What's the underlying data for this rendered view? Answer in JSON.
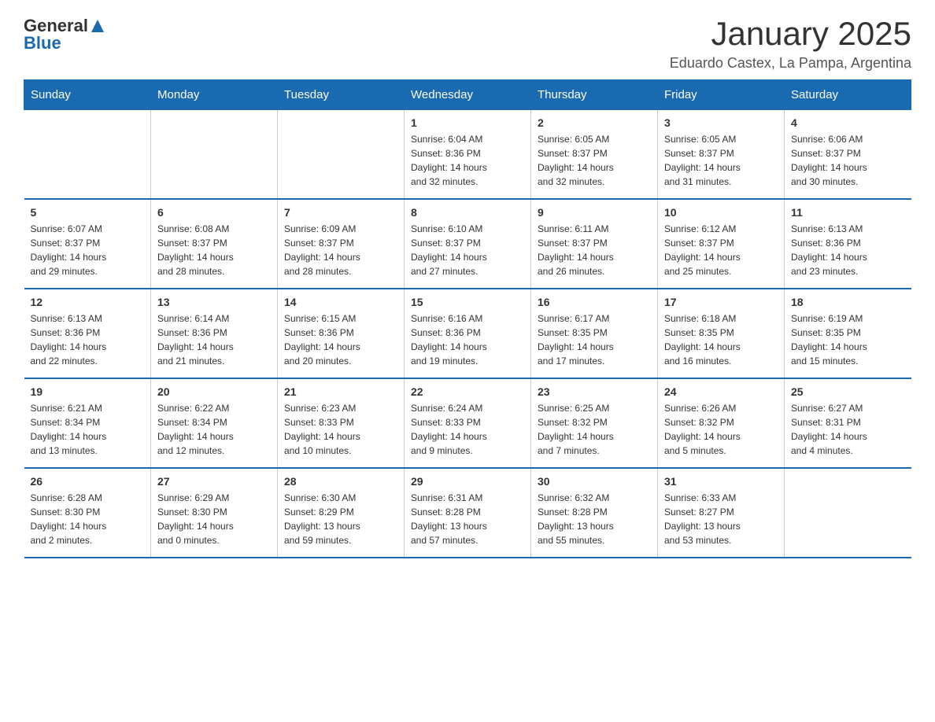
{
  "header": {
    "logo_general": "General",
    "logo_blue": "Blue",
    "month_title": "January 2025",
    "location": "Eduardo Castex, La Pampa, Argentina"
  },
  "weekdays": [
    "Sunday",
    "Monday",
    "Tuesday",
    "Wednesday",
    "Thursday",
    "Friday",
    "Saturday"
  ],
  "weeks": [
    [
      {
        "day": "",
        "info": ""
      },
      {
        "day": "",
        "info": ""
      },
      {
        "day": "",
        "info": ""
      },
      {
        "day": "1",
        "info": "Sunrise: 6:04 AM\nSunset: 8:36 PM\nDaylight: 14 hours\nand 32 minutes."
      },
      {
        "day": "2",
        "info": "Sunrise: 6:05 AM\nSunset: 8:37 PM\nDaylight: 14 hours\nand 32 minutes."
      },
      {
        "day": "3",
        "info": "Sunrise: 6:05 AM\nSunset: 8:37 PM\nDaylight: 14 hours\nand 31 minutes."
      },
      {
        "day": "4",
        "info": "Sunrise: 6:06 AM\nSunset: 8:37 PM\nDaylight: 14 hours\nand 30 minutes."
      }
    ],
    [
      {
        "day": "5",
        "info": "Sunrise: 6:07 AM\nSunset: 8:37 PM\nDaylight: 14 hours\nand 29 minutes."
      },
      {
        "day": "6",
        "info": "Sunrise: 6:08 AM\nSunset: 8:37 PM\nDaylight: 14 hours\nand 28 minutes."
      },
      {
        "day": "7",
        "info": "Sunrise: 6:09 AM\nSunset: 8:37 PM\nDaylight: 14 hours\nand 28 minutes."
      },
      {
        "day": "8",
        "info": "Sunrise: 6:10 AM\nSunset: 8:37 PM\nDaylight: 14 hours\nand 27 minutes."
      },
      {
        "day": "9",
        "info": "Sunrise: 6:11 AM\nSunset: 8:37 PM\nDaylight: 14 hours\nand 26 minutes."
      },
      {
        "day": "10",
        "info": "Sunrise: 6:12 AM\nSunset: 8:37 PM\nDaylight: 14 hours\nand 25 minutes."
      },
      {
        "day": "11",
        "info": "Sunrise: 6:13 AM\nSunset: 8:36 PM\nDaylight: 14 hours\nand 23 minutes."
      }
    ],
    [
      {
        "day": "12",
        "info": "Sunrise: 6:13 AM\nSunset: 8:36 PM\nDaylight: 14 hours\nand 22 minutes."
      },
      {
        "day": "13",
        "info": "Sunrise: 6:14 AM\nSunset: 8:36 PM\nDaylight: 14 hours\nand 21 minutes."
      },
      {
        "day": "14",
        "info": "Sunrise: 6:15 AM\nSunset: 8:36 PM\nDaylight: 14 hours\nand 20 minutes."
      },
      {
        "day": "15",
        "info": "Sunrise: 6:16 AM\nSunset: 8:36 PM\nDaylight: 14 hours\nand 19 minutes."
      },
      {
        "day": "16",
        "info": "Sunrise: 6:17 AM\nSunset: 8:35 PM\nDaylight: 14 hours\nand 17 minutes."
      },
      {
        "day": "17",
        "info": "Sunrise: 6:18 AM\nSunset: 8:35 PM\nDaylight: 14 hours\nand 16 minutes."
      },
      {
        "day": "18",
        "info": "Sunrise: 6:19 AM\nSunset: 8:35 PM\nDaylight: 14 hours\nand 15 minutes."
      }
    ],
    [
      {
        "day": "19",
        "info": "Sunrise: 6:21 AM\nSunset: 8:34 PM\nDaylight: 14 hours\nand 13 minutes."
      },
      {
        "day": "20",
        "info": "Sunrise: 6:22 AM\nSunset: 8:34 PM\nDaylight: 14 hours\nand 12 minutes."
      },
      {
        "day": "21",
        "info": "Sunrise: 6:23 AM\nSunset: 8:33 PM\nDaylight: 14 hours\nand 10 minutes."
      },
      {
        "day": "22",
        "info": "Sunrise: 6:24 AM\nSunset: 8:33 PM\nDaylight: 14 hours\nand 9 minutes."
      },
      {
        "day": "23",
        "info": "Sunrise: 6:25 AM\nSunset: 8:32 PM\nDaylight: 14 hours\nand 7 minutes."
      },
      {
        "day": "24",
        "info": "Sunrise: 6:26 AM\nSunset: 8:32 PM\nDaylight: 14 hours\nand 5 minutes."
      },
      {
        "day": "25",
        "info": "Sunrise: 6:27 AM\nSunset: 8:31 PM\nDaylight: 14 hours\nand 4 minutes."
      }
    ],
    [
      {
        "day": "26",
        "info": "Sunrise: 6:28 AM\nSunset: 8:30 PM\nDaylight: 14 hours\nand 2 minutes."
      },
      {
        "day": "27",
        "info": "Sunrise: 6:29 AM\nSunset: 8:30 PM\nDaylight: 14 hours\nand 0 minutes."
      },
      {
        "day": "28",
        "info": "Sunrise: 6:30 AM\nSunset: 8:29 PM\nDaylight: 13 hours\nand 59 minutes."
      },
      {
        "day": "29",
        "info": "Sunrise: 6:31 AM\nSunset: 8:28 PM\nDaylight: 13 hours\nand 57 minutes."
      },
      {
        "day": "30",
        "info": "Sunrise: 6:32 AM\nSunset: 8:28 PM\nDaylight: 13 hours\nand 55 minutes."
      },
      {
        "day": "31",
        "info": "Sunrise: 6:33 AM\nSunset: 8:27 PM\nDaylight: 13 hours\nand 53 minutes."
      },
      {
        "day": "",
        "info": ""
      }
    ]
  ]
}
